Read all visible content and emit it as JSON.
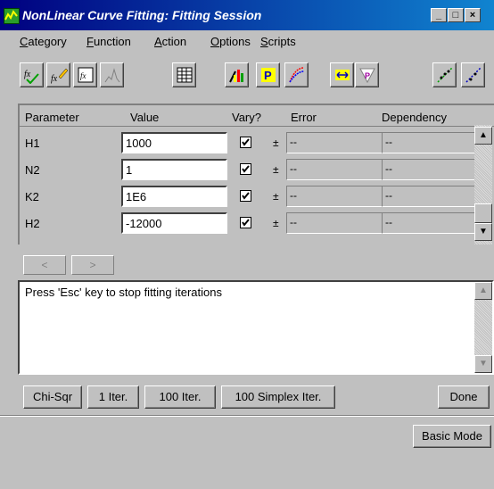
{
  "window": {
    "title": "NonLinear Curve Fitting:  Fitting Session",
    "minimize": "_",
    "maximize": "□",
    "close": "×"
  },
  "menu": {
    "items": [
      {
        "label": "Category",
        "accel": "C"
      },
      {
        "label": "Function",
        "accel": "F"
      },
      {
        "label": "Action",
        "accel": "A"
      },
      {
        "label": "Options",
        "accel": "O"
      },
      {
        "label": "Scripts",
        "accel": "S"
      }
    ]
  },
  "toolbar": {
    "buttons": [
      "select-function-icon",
      "edit-function-icon",
      "function-view-icon",
      "simulate-curve-icon",
      "parameters-worksheet-icon",
      "variables-icon",
      "parameter-bounds-icon",
      "data-range-icon",
      "adjust-range-icon",
      "weighting-icon",
      "fit-results-icon",
      "residuals-icon"
    ]
  },
  "grid": {
    "headers": [
      "Parameter",
      "Value",
      "Vary?",
      "Error",
      "Dependency"
    ],
    "rows": [
      {
        "param": "H1",
        "value": "1000",
        "vary": true,
        "pm": "±",
        "error": "--",
        "dependency": "--"
      },
      {
        "param": "N2",
        "value": "1",
        "vary": true,
        "pm": "±",
        "error": "--",
        "dependency": "--"
      },
      {
        "param": "K2",
        "value": "1E6",
        "vary": true,
        "pm": "±",
        "error": "--",
        "dependency": "--"
      },
      {
        "param": "H2",
        "value": "-12000",
        "vary": true,
        "pm": "±",
        "error": "--",
        "dependency": "--"
      }
    ]
  },
  "nav": {
    "prev": "<",
    "next": ">"
  },
  "message": "Press 'Esc' key to stop fitting iterations",
  "buttons": {
    "chi_sqr": "Chi-Sqr",
    "iter1": "1 Iter.",
    "iter100": "100 Iter.",
    "simplex": "100 Simplex Iter.",
    "done": "Done",
    "basic_mode": "Basic Mode"
  },
  "colors": {
    "title_start": "#000080",
    "title_end": "#1084d0",
    "face": "#c0c0c0"
  }
}
